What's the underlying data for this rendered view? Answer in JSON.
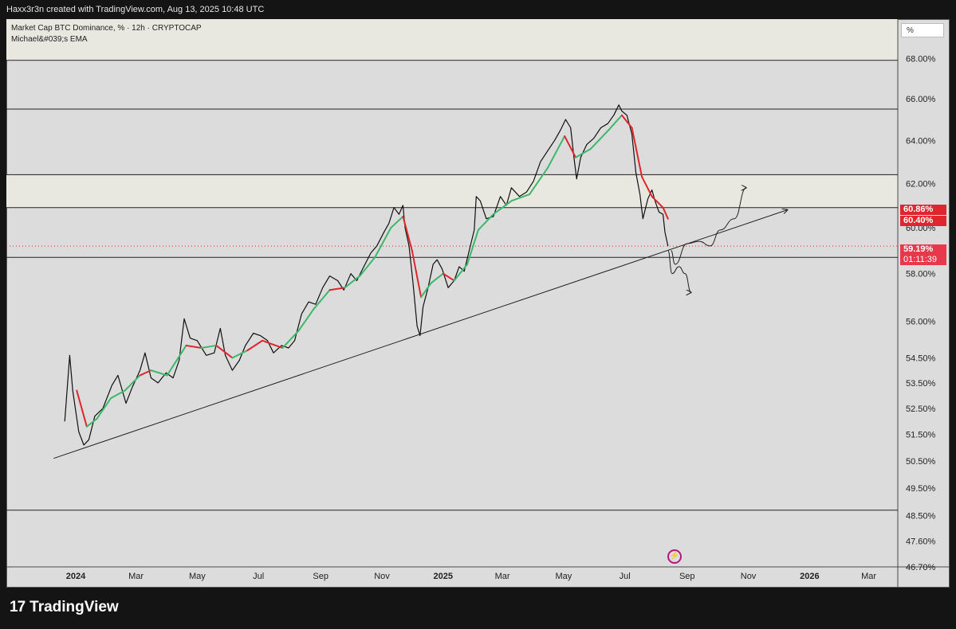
{
  "header": {
    "credit": "Haxx3r3n created with TradingView.com, Aug 13, 2025 10:48 UTC"
  },
  "legend": {
    "line1": "Market Cap BTC Dominance, % · 12h · CRYPTOCAP",
    "line2": "Michael&#039;s EMA"
  },
  "scale_button": {
    "label": "%"
  },
  "price_tags": [
    {
      "label": "60.86%",
      "value": 60.86,
      "color": "#e0262d"
    },
    {
      "label": "60.40%",
      "value": 60.4,
      "color": "#e0262d"
    },
    {
      "label": "59.19%",
      "value": 59.19,
      "color": "#e8384c"
    },
    {
      "label": "01:11:39",
      "value": 58.7,
      "color": "#e8384c"
    }
  ],
  "brand": {
    "logo": "17",
    "name": "TradingView"
  },
  "icons": {
    "bolt": "lightning-bolt-icon"
  },
  "chart_data": {
    "type": "line",
    "title": "Market Cap BTC Dominance, % · 12h · CRYPTOCAP",
    "y_axis": {
      "scale": "log",
      "range": [
        46.7,
        70.0
      ],
      "tick_labels": [
        "68.00%",
        "66.00%",
        "64.00%",
        "62.00%",
        "60.00%",
        "58.00%",
        "56.00%",
        "54.50%",
        "53.50%",
        "52.50%",
        "51.50%",
        "50.50%",
        "49.50%",
        "48.50%",
        "47.60%",
        "46.70%"
      ],
      "tick_values": [
        68.0,
        66.0,
        64.0,
        62.0,
        60.0,
        58.0,
        56.0,
        54.5,
        53.5,
        52.5,
        51.5,
        50.5,
        49.5,
        48.5,
        47.6,
        46.7
      ]
    },
    "x_axis": {
      "ticks": [
        {
          "label": "2024",
          "date": "2024-01-01",
          "bold": true
        },
        {
          "label": "Mar",
          "date": "2024-03-01"
        },
        {
          "label": "May",
          "date": "2024-05-01"
        },
        {
          "label": "Jul",
          "date": "2024-07-01"
        },
        {
          "label": "Sep",
          "date": "2024-09-01"
        },
        {
          "label": "Nov",
          "date": "2024-11-01"
        },
        {
          "label": "2025",
          "date": "2025-01-01",
          "bold": true
        },
        {
          "label": "Mar",
          "date": "2025-03-01"
        },
        {
          "label": "May",
          "date": "2025-05-01"
        },
        {
          "label": "Jul",
          "date": "2025-07-01"
        },
        {
          "label": "Sep",
          "date": "2025-09-01"
        },
        {
          "label": "Nov",
          "date": "2025-11-01"
        },
        {
          "label": "2026",
          "date": "2026-01-01",
          "bold": true
        },
        {
          "label": "Mar",
          "date": "2026-03-01"
        }
      ]
    },
    "series": [
      {
        "name": "BTC Dominance",
        "color": "#111111",
        "points": [
          [
            "2023-12-21",
            52.0
          ],
          [
            "2023-12-26",
            54.6
          ],
          [
            "2023-12-29",
            53.2
          ],
          [
            "2024-01-04",
            51.6
          ],
          [
            "2024-01-09",
            51.1
          ],
          [
            "2024-01-14",
            51.3
          ],
          [
            "2024-01-20",
            52.2
          ],
          [
            "2024-01-28",
            52.5
          ],
          [
            "2024-02-06",
            53.4
          ],
          [
            "2024-02-12",
            53.8
          ],
          [
            "2024-02-20",
            52.7
          ],
          [
            "2024-02-26",
            53.3
          ],
          [
            "2024-03-05",
            54.0
          ],
          [
            "2024-03-10",
            54.7
          ],
          [
            "2024-03-16",
            53.7
          ],
          [
            "2024-03-23",
            53.5
          ],
          [
            "2024-03-31",
            53.9
          ],
          [
            "2024-04-07",
            53.7
          ],
          [
            "2024-04-13",
            54.4
          ],
          [
            "2024-04-18",
            56.1
          ],
          [
            "2024-04-24",
            55.3
          ],
          [
            "2024-05-01",
            55.2
          ],
          [
            "2024-05-10",
            54.6
          ],
          [
            "2024-05-18",
            54.7
          ],
          [
            "2024-05-24",
            55.7
          ],
          [
            "2024-05-29",
            54.6
          ],
          [
            "2024-06-05",
            54.0
          ],
          [
            "2024-06-12",
            54.4
          ],
          [
            "2024-06-18",
            55.0
          ],
          [
            "2024-06-26",
            55.5
          ],
          [
            "2024-07-03",
            55.4
          ],
          [
            "2024-07-10",
            55.2
          ],
          [
            "2024-07-16",
            54.7
          ],
          [
            "2024-07-24",
            55.0
          ],
          [
            "2024-07-31",
            54.9
          ],
          [
            "2024-08-06",
            55.2
          ],
          [
            "2024-08-13",
            56.3
          ],
          [
            "2024-08-20",
            56.8
          ],
          [
            "2024-08-27",
            56.7
          ],
          [
            "2024-09-03",
            57.4
          ],
          [
            "2024-09-10",
            57.9
          ],
          [
            "2024-09-18",
            57.7
          ],
          [
            "2024-09-24",
            57.3
          ],
          [
            "2024-10-01",
            58.0
          ],
          [
            "2024-10-07",
            57.7
          ],
          [
            "2024-10-14",
            58.3
          ],
          [
            "2024-10-21",
            58.9
          ],
          [
            "2024-10-27",
            59.2
          ],
          [
            "2024-11-03",
            59.8
          ],
          [
            "2024-11-08",
            60.2
          ],
          [
            "2024-11-13",
            60.9
          ],
          [
            "2024-11-18",
            60.6
          ],
          [
            "2024-11-22",
            61.0
          ],
          [
            "2024-11-24",
            60.0
          ],
          [
            "2024-11-28",
            59.2
          ],
          [
            "2024-12-02",
            57.6
          ],
          [
            "2024-12-06",
            55.8
          ],
          [
            "2024-12-09",
            55.4
          ],
          [
            "2024-12-12",
            56.6
          ],
          [
            "2024-12-17",
            57.4
          ],
          [
            "2024-12-22",
            58.4
          ],
          [
            "2024-12-26",
            58.6
          ],
          [
            "2024-12-31",
            58.2
          ],
          [
            "2025-01-06",
            57.4
          ],
          [
            "2025-01-12",
            57.7
          ],
          [
            "2025-01-17",
            58.3
          ],
          [
            "2025-01-22",
            58.1
          ],
          [
            "2025-01-27",
            59.0
          ],
          [
            "2025-02-01",
            59.9
          ],
          [
            "2025-02-03",
            61.4
          ],
          [
            "2025-02-07",
            61.2
          ],
          [
            "2025-02-13",
            60.4
          ],
          [
            "2025-02-20",
            60.5
          ],
          [
            "2025-02-27",
            61.4
          ],
          [
            "2025-03-05",
            61.0
          ],
          [
            "2025-03-10",
            61.8
          ],
          [
            "2025-03-18",
            61.4
          ],
          [
            "2025-03-25",
            61.6
          ],
          [
            "2025-04-01",
            62.1
          ],
          [
            "2025-04-08",
            63.0
          ],
          [
            "2025-04-15",
            63.5
          ],
          [
            "2025-04-22",
            64.0
          ],
          [
            "2025-04-28",
            64.5
          ],
          [
            "2025-05-03",
            65.0
          ],
          [
            "2025-05-08",
            64.6
          ],
          [
            "2025-05-11",
            63.3
          ],
          [
            "2025-05-14",
            62.2
          ],
          [
            "2025-05-18",
            63.2
          ],
          [
            "2025-05-24",
            63.8
          ],
          [
            "2025-05-31",
            64.1
          ],
          [
            "2025-06-07",
            64.6
          ],
          [
            "2025-06-14",
            64.8
          ],
          [
            "2025-06-20",
            65.2
          ],
          [
            "2025-06-25",
            65.7
          ],
          [
            "2025-06-28",
            65.4
          ],
          [
            "2025-07-03",
            65.2
          ],
          [
            "2025-07-08",
            64.3
          ],
          [
            "2025-07-12",
            62.5
          ],
          [
            "2025-07-16",
            61.5
          ],
          [
            "2025-07-19",
            60.4
          ],
          [
            "2025-07-24",
            61.3
          ],
          [
            "2025-07-28",
            61.7
          ],
          [
            "2025-07-31",
            61.2
          ],
          [
            "2025-08-04",
            60.7
          ],
          [
            "2025-08-08",
            60.6
          ],
          [
            "2025-08-10",
            59.8
          ],
          [
            "2025-08-13",
            59.19
          ]
        ]
      },
      {
        "name": "Michael's EMA",
        "colors": {
          "up": "#3db86b",
          "down": "#e0262d"
        },
        "points": [
          [
            "2024-01-02",
            53.2,
            "down"
          ],
          [
            "2024-01-12",
            51.8,
            "down"
          ],
          [
            "2024-01-22",
            52.1,
            "up"
          ],
          [
            "2024-02-05",
            52.9,
            "up"
          ],
          [
            "2024-02-19",
            53.2,
            "up"
          ],
          [
            "2024-03-05",
            53.8,
            "up"
          ],
          [
            "2024-03-16",
            54.0,
            "down"
          ],
          [
            "2024-04-01",
            53.8,
            "up"
          ],
          [
            "2024-04-20",
            55.0,
            "up"
          ],
          [
            "2024-05-05",
            54.9,
            "down"
          ],
          [
            "2024-05-20",
            55.0,
            "up"
          ],
          [
            "2024-06-05",
            54.5,
            "down"
          ],
          [
            "2024-06-20",
            54.8,
            "up"
          ],
          [
            "2024-07-05",
            55.2,
            "down"
          ],
          [
            "2024-07-25",
            54.9,
            "down"
          ],
          [
            "2024-08-10",
            55.6,
            "up"
          ],
          [
            "2024-08-25",
            56.5,
            "up"
          ],
          [
            "2024-09-10",
            57.3,
            "up"
          ],
          [
            "2024-09-25",
            57.4,
            "down"
          ],
          [
            "2024-10-10",
            57.9,
            "up"
          ],
          [
            "2024-10-25",
            58.7,
            "up"
          ],
          [
            "2024-11-10",
            60.0,
            "up"
          ],
          [
            "2024-11-22",
            60.5,
            "up"
          ],
          [
            "2024-12-01",
            59.0,
            "down"
          ],
          [
            "2024-12-10",
            57.0,
            "down"
          ],
          [
            "2024-12-20",
            57.6,
            "up"
          ],
          [
            "2025-01-01",
            58.0,
            "up"
          ],
          [
            "2025-01-12",
            57.7,
            "down"
          ],
          [
            "2025-01-25",
            58.4,
            "up"
          ],
          [
            "2025-02-05",
            59.9,
            "up"
          ],
          [
            "2025-02-20",
            60.6,
            "up"
          ],
          [
            "2025-03-10",
            61.2,
            "up"
          ],
          [
            "2025-03-28",
            61.5,
            "up"
          ],
          [
            "2025-04-15",
            62.7,
            "up"
          ],
          [
            "2025-05-02",
            64.2,
            "up"
          ],
          [
            "2025-05-13",
            63.2,
            "down"
          ],
          [
            "2025-05-28",
            63.6,
            "up"
          ],
          [
            "2025-06-15",
            64.5,
            "up"
          ],
          [
            "2025-06-28",
            65.2,
            "up"
          ],
          [
            "2025-07-08",
            64.6,
            "down"
          ],
          [
            "2025-07-18",
            62.3,
            "down"
          ],
          [
            "2025-07-28",
            61.4,
            "down"
          ],
          [
            "2025-08-08",
            60.9,
            "down"
          ],
          [
            "2025-08-13",
            60.4,
            "down"
          ]
        ]
      }
    ],
    "horizontal_lines": [
      67.9,
      65.5,
      62.4,
      60.9,
      58.7,
      48.7
    ],
    "shaded_zones": [
      {
        "from": 67.9,
        "to": 70.0,
        "color": "#e8e8e0"
      },
      {
        "from": 60.9,
        "to": 62.4,
        "color": "#e8e8e0"
      }
    ],
    "dotted_lines": [
      59.19
    ],
    "drawn_lines": [
      {
        "name": "trendline",
        "from": [
          "2023-12-10",
          50.6
        ],
        "to": [
          "2025-12-10",
          60.8
        ],
        "arrow": true
      },
      {
        "name": "bullish-scenario",
        "points": [
          [
            "2025-08-16",
            59.0
          ],
          [
            "2025-08-20",
            58.4
          ],
          [
            "2025-09-01",
            59.3
          ],
          [
            "2025-09-13",
            59.4
          ],
          [
            "2025-09-24",
            59.2
          ],
          [
            "2025-10-04",
            59.9
          ],
          [
            "2025-10-18",
            60.4
          ],
          [
            "2025-10-30",
            61.8
          ]
        ],
        "arrow": true
      },
      {
        "name": "bearish-scenario",
        "points": [
          [
            "2025-08-13",
            59.0
          ],
          [
            "2025-08-17",
            58.0
          ],
          [
            "2025-08-24",
            58.3
          ],
          [
            "2025-08-30",
            58.0
          ],
          [
            "2025-09-05",
            57.2
          ]
        ],
        "arrow": true
      }
    ],
    "grid": false,
    "legend_position": "top-left"
  }
}
